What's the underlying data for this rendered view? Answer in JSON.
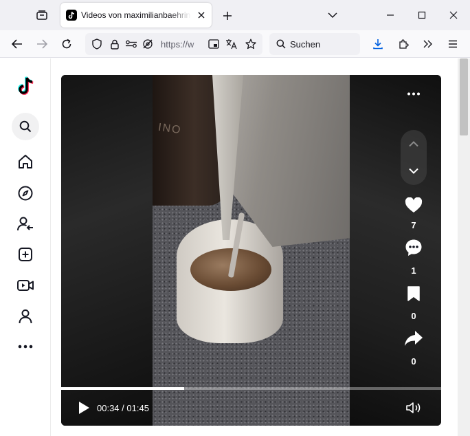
{
  "browser": {
    "tab_title": "Videos von maximilianbaehring",
    "url_display": "https://w",
    "search_placeholder": "Suchen"
  },
  "colors": {
    "tiktok_cyan": "#25f4ee",
    "tiktok_red": "#fe2c55",
    "firefox_blue": "#0060df"
  },
  "sidebar": {
    "items": [
      {
        "name": "tiktok-logo",
        "icon": "tiktok-logo"
      },
      {
        "name": "search",
        "icon": "search-icon"
      },
      {
        "name": "home",
        "icon": "home-icon"
      },
      {
        "name": "explore",
        "icon": "compass-icon"
      },
      {
        "name": "following",
        "icon": "user-follow-icon"
      },
      {
        "name": "upload",
        "icon": "plus-square-icon"
      },
      {
        "name": "live",
        "icon": "video-camera-icon"
      },
      {
        "name": "profile",
        "icon": "user-icon"
      },
      {
        "name": "more",
        "icon": "more-horizontal-icon"
      }
    ]
  },
  "video": {
    "frame_label": "INO",
    "likes": "7",
    "comments": "1",
    "bookmarks": "0",
    "shares": "0",
    "time_current": "00:34",
    "time_total": "01:45",
    "time_separator": " / ",
    "progress_fraction": 0.324
  }
}
